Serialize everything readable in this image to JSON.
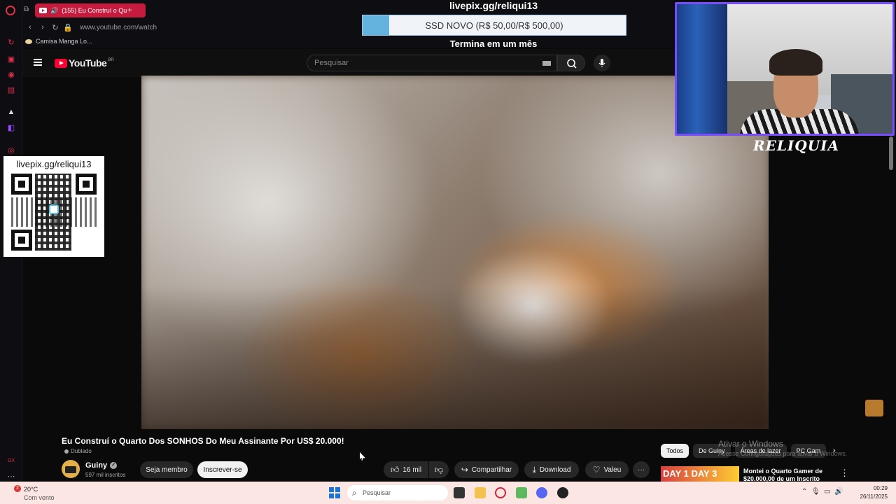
{
  "browser": {
    "tab_title": "(155) Eu Construí o Qu",
    "url": "www.youtube.com/watch",
    "bookmark": "Camisa Manga Lo..."
  },
  "youtube": {
    "logo_text": "YouTube",
    "region": "BR",
    "search_placeholder": "Pesquisar"
  },
  "overlay": {
    "donation_link": "livepix.gg/reliqui13",
    "goal_text": "SSD NOVO (R$ 50,00/R$ 500,00)",
    "goal_progress": 0.1,
    "goal_deadline": "Termina em um mês",
    "qr_link": "livepix.gg/reliqui13",
    "streamer_name": "RELIQUIA"
  },
  "video": {
    "title": "Eu Construí o Quarto Dos SONHOS Do Meu Assinante Por US$ 20.000!",
    "badge": "Dublado",
    "channel": "Guiny",
    "subscribers": "597 mil inscritos",
    "join_label": "Seja membro",
    "subscribe_label": "Inscrever-se",
    "likes": "16 mil",
    "share_label": "Compartilhar",
    "download_label": "Download",
    "thanks_label": "Valeu",
    "more_label": "···"
  },
  "chips": [
    "Todos",
    "De Guiny",
    "Áreas de lazer",
    "PC Gam"
  ],
  "watermark": {
    "line1": "Ativar o Windows",
    "line2": "Acesse Configurações para ativar o Windows."
  },
  "recommendation": {
    "thumb_text": "DAY 1  DAY 3",
    "title": "Montei o Quarto Gamer de $20.000,00 de um Inscrito"
  },
  "taskbar": {
    "weather_badge": "2",
    "temperature": "20°C",
    "condition": "Com vento",
    "search_placeholder": "Pesquisar",
    "time": "00:29",
    "date": "26/11/2025"
  },
  "colors": {
    "opera_tab": "#c61b3c",
    "youtube_red": "#ff0033",
    "cam_border": "#7a4cff",
    "goal_fill": "#64b3df"
  }
}
